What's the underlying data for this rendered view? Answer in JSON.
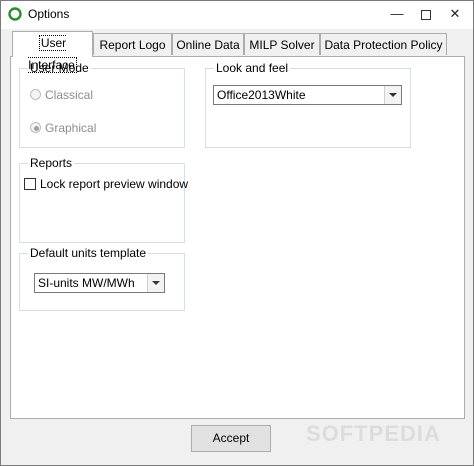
{
  "window": {
    "title": "Options",
    "controls": {
      "minimize": "—",
      "close": "✕"
    }
  },
  "tabs": [
    {
      "label": "User Interface",
      "active": true
    },
    {
      "label": "Report Logo",
      "active": false
    },
    {
      "label": "Online Data",
      "active": false
    },
    {
      "label": "MILP Solver",
      "active": false
    },
    {
      "label": "Data Protection Policy",
      "active": false
    }
  ],
  "user_mode": {
    "title": "User Mode",
    "options": [
      {
        "label": "Classical",
        "selected": false
      },
      {
        "label": "Graphical",
        "selected": true
      }
    ]
  },
  "look_and_feel": {
    "title": "Look and feel",
    "selected": "Office2013White"
  },
  "reports": {
    "title": "Reports",
    "lock_preview_label": "Lock report preview window",
    "lock_preview_checked": false
  },
  "default_units": {
    "title": "Default units template",
    "selected": "SI-units MW/MWh"
  },
  "footer": {
    "accept_label": "Accept",
    "watermark": "SOFTPEDIA"
  }
}
